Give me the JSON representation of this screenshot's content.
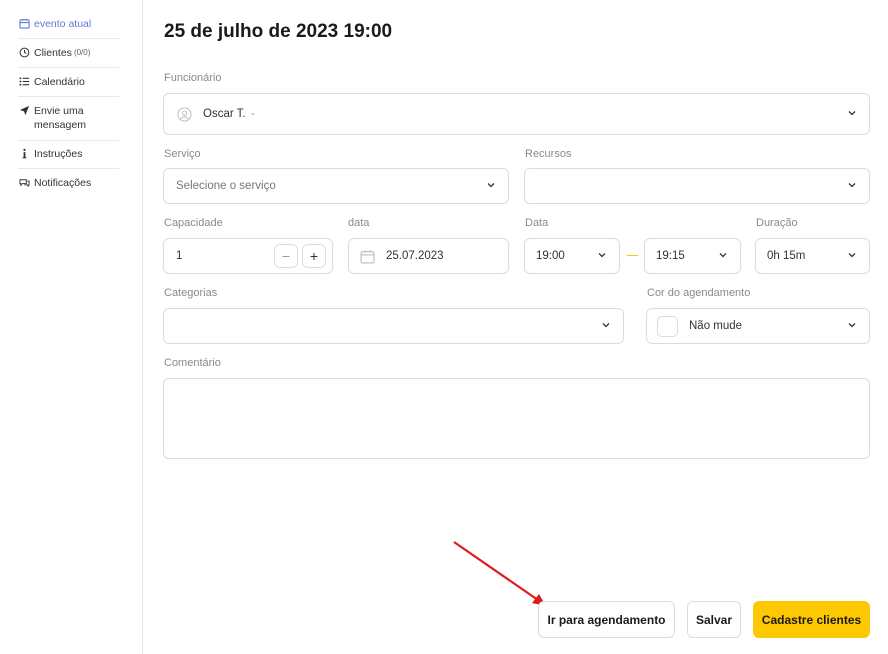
{
  "sidebar": {
    "items": [
      {
        "label": "evento atual",
        "icon": "calendar-icon",
        "active": true
      },
      {
        "label": "Clientes",
        "badge": "(0/0)",
        "icon": "clock-icon"
      },
      {
        "label": "Calendário",
        "icon": "list-icon"
      },
      {
        "label": "Envie uma mensagem",
        "icon": "send-icon"
      },
      {
        "label": "Instruções",
        "icon": "info-icon"
      },
      {
        "label": "Notificações",
        "icon": "chat-icon"
      }
    ]
  },
  "header": {
    "title": "25 de julho de 2023 19:00"
  },
  "form": {
    "employee_label": "Funcionário",
    "employee_value": "Oscar T.",
    "employee_suffix": "-",
    "service_label": "Serviço",
    "service_placeholder": "Selecione o serviço",
    "resources_label": "Recursos",
    "resources_value": "",
    "capacity_label": "Capacidade",
    "capacity_value": "1",
    "minus": "−",
    "plus": "+",
    "date_label": "data",
    "date_value": "25.07.2023",
    "time_label": "Data",
    "time_start": "19:00",
    "time_end": "19:15",
    "duration_label": "Duração",
    "duration_value": "0h 15m",
    "categories_label": "Categorias",
    "categories_value": "",
    "color_label": "Cor do agendamento",
    "color_value": "Não mude",
    "comment_label": "Comentário",
    "comment_value": ""
  },
  "actions": {
    "go_to_booking": "Ir para agendamento",
    "save": "Salvar",
    "register_clients": "Cadastre clientes"
  },
  "colors": {
    "accent": "#fdc800",
    "active_nav": "#5b7bd5",
    "arrow": "#e21b1b",
    "dash": "#f5c518"
  }
}
